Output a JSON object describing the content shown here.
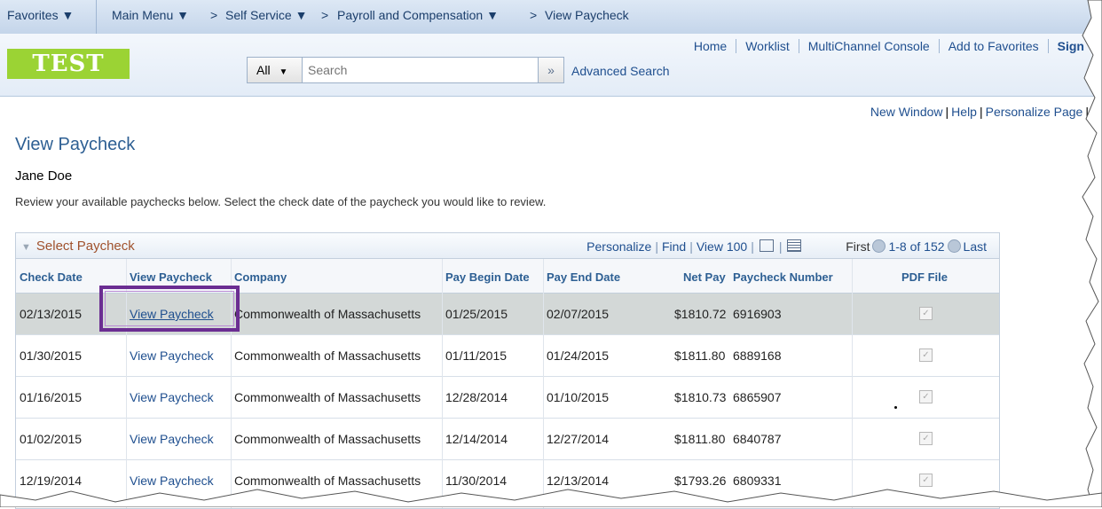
{
  "nav": {
    "favorites": "Favorites",
    "main_menu": "Main Menu",
    "self_service": "Self Service",
    "payroll": "Payroll and Compensation",
    "current": "View Paycheck",
    "sep": ">"
  },
  "header": {
    "logo": "TEST",
    "links": [
      "Home",
      "Worklist",
      "MultiChannel Console",
      "Add to Favorites",
      "Sign"
    ],
    "search_scope": "All",
    "search_placeholder": "Search",
    "advanced_search": "Advanced Search"
  },
  "page_links": {
    "new_window": "New Window",
    "help": "Help",
    "personalize_page": "Personalize Page"
  },
  "page": {
    "title": "View Paycheck",
    "employee_name": "Jane Doe",
    "instructions": "Review your available paychecks below. Select the check date of the paycheck you would like to review."
  },
  "grid": {
    "title": "Select Paycheck",
    "personalize": "Personalize",
    "find": "Find",
    "view100": "View 100",
    "first": "First",
    "range": "1-8 of 152",
    "last": "Last",
    "columns": [
      "Check Date",
      "View Paycheck",
      "Company",
      "Pay Begin Date",
      "Pay End Date",
      "Net Pay",
      "Paycheck Number",
      "PDF File"
    ],
    "rows": [
      {
        "check_date": "02/13/2015",
        "view": "View Paycheck",
        "company": "Commonwealth of Massachusetts",
        "begin": "01/25/2015",
        "end": "02/07/2015",
        "net": "$1810.72",
        "number": "6916903",
        "selected": true
      },
      {
        "check_date": "01/30/2015",
        "view": "View Paycheck",
        "company": "Commonwealth of Massachusetts",
        "begin": "01/11/2015",
        "end": "01/24/2015",
        "net": "$1811.80",
        "number": "6889168",
        "selected": false
      },
      {
        "check_date": "01/16/2015",
        "view": "View Paycheck",
        "company": "Commonwealth of Massachusetts",
        "begin": "12/28/2014",
        "end": "01/10/2015",
        "net": "$1810.73",
        "number": "6865907",
        "selected": false
      },
      {
        "check_date": "01/02/2015",
        "view": "View Paycheck",
        "company": "Commonwealth of Massachusetts",
        "begin": "12/14/2014",
        "end": "12/27/2014",
        "net": "$1811.80",
        "number": "6840787",
        "selected": false
      },
      {
        "check_date": "12/19/2014",
        "view": "View Paycheck",
        "company": "Commonwealth of Massachusetts",
        "begin": "11/30/2014",
        "end": "12/13/2014",
        "net": "$1793.26",
        "number": "6809331",
        "selected": false
      }
    ]
  },
  "colors": {
    "accent": "#1f4f8f",
    "logo_bg": "#9bd334",
    "highlight": "#6b2d92",
    "grid_title": "#a0522d"
  }
}
